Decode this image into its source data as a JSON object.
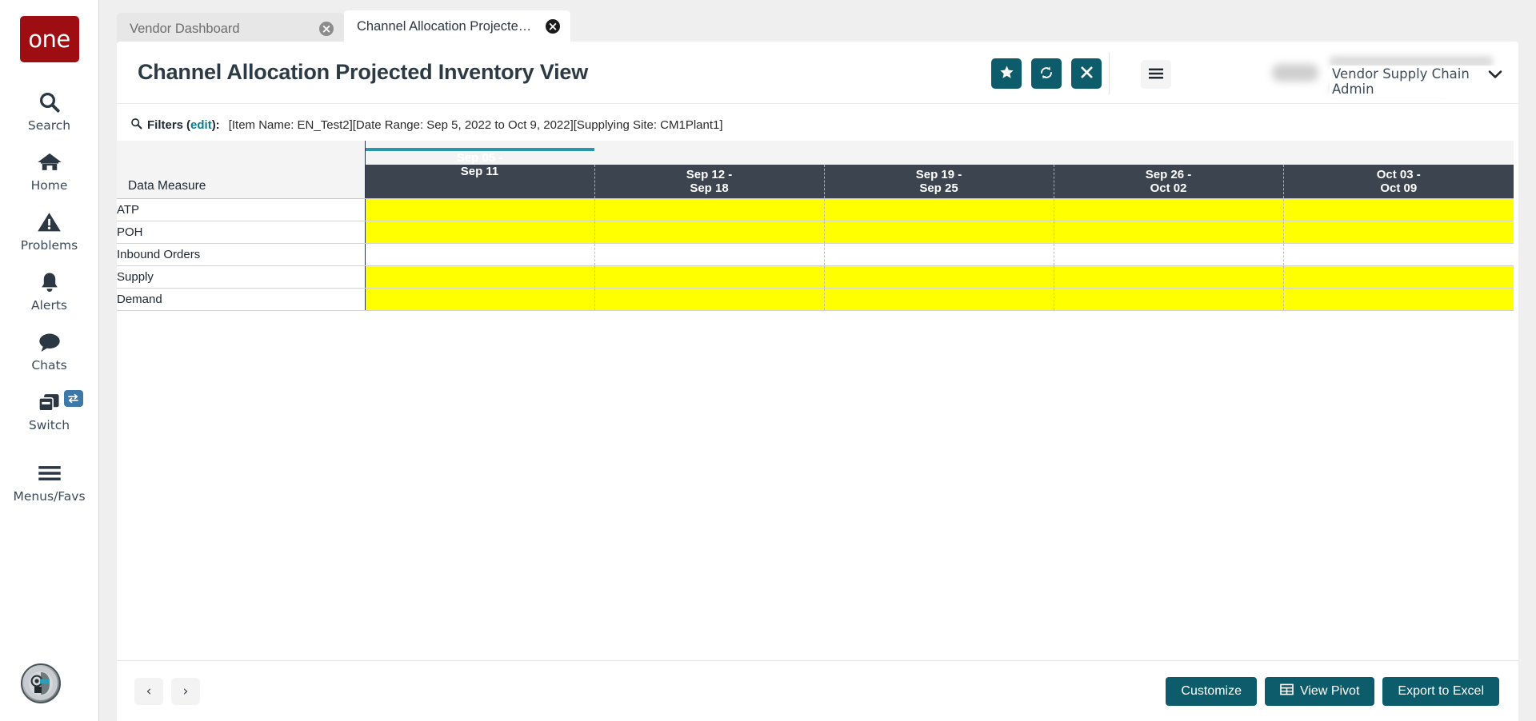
{
  "sidebar": {
    "logo_text": "one",
    "items": [
      {
        "label": "Search",
        "icon": "search-icon"
      },
      {
        "label": "Home",
        "icon": "home-icon"
      },
      {
        "label": "Problems",
        "icon": "warning-triangle-icon"
      },
      {
        "label": "Alerts",
        "icon": "bell-icon"
      },
      {
        "label": "Chats",
        "icon": "chat-bubble-icon"
      },
      {
        "label": "Switch",
        "icon": "switch-windows-icon",
        "badge": "swap-arrows-icon"
      },
      {
        "label": "Menus/Favs",
        "icon": "hamburger-icon"
      }
    ],
    "avatar": "assistant-avatar-icon"
  },
  "tabs": [
    {
      "label": "Vendor Dashboard",
      "active": false
    },
    {
      "label": "Channel Allocation Projected Inv...",
      "active": true
    }
  ],
  "header": {
    "title": "Channel Allocation Projected Inventory View",
    "actions": [
      {
        "name": "favorite-button",
        "icon": "star-icon"
      },
      {
        "name": "refresh-button",
        "icon": "refresh-icon"
      },
      {
        "name": "close-button",
        "icon": "close-x-icon"
      }
    ],
    "menu_icon": "hamburger-icon",
    "user_role": "Vendor Supply Chain Admin",
    "caret_icon": "chevron-down-icon"
  },
  "filters": {
    "icon": "search-icon",
    "label": "Filters",
    "edit_label": "edit",
    "suffix": "):",
    "open_paren": "(",
    "value": "[Item Name: EN_Test2][Date Range: Sep 5, 2022 to Oct 9, 2022][Supplying Site: CM1Plant1]"
  },
  "table": {
    "corner_header": "Data Measure",
    "columns": [
      {
        "line1": "Sep 05 -",
        "line2": "Sep 11",
        "accent": true
      },
      {
        "line1": "Sep 12 -",
        "line2": "Sep 18",
        "accent": false
      },
      {
        "line1": "Sep 19 -",
        "line2": "Sep 25",
        "accent": false
      },
      {
        "line1": "Sep 26 -",
        "line2": "Oct 02",
        "accent": false
      },
      {
        "line1": "Oct 03 -",
        "line2": "Oct 09",
        "accent": false
      }
    ],
    "rows": [
      {
        "measure": "ATP",
        "highlight": "yellow",
        "values": [
          "",
          "",
          "",
          "",
          ""
        ]
      },
      {
        "measure": "POH",
        "highlight": "yellow",
        "values": [
          "",
          "",
          "",
          "",
          ""
        ]
      },
      {
        "measure": "Inbound Orders",
        "highlight": "white",
        "values": [
          "",
          "",
          "",
          "",
          ""
        ]
      },
      {
        "measure": "Supply",
        "highlight": "yellow",
        "values": [
          "",
          "",
          "",
          "",
          ""
        ]
      },
      {
        "measure": "Demand",
        "highlight": "yellow",
        "values": [
          "",
          "",
          "",
          "",
          ""
        ]
      }
    ]
  },
  "bottom": {
    "prev_label": "‹",
    "next_label": "›",
    "customize_label": "Customize",
    "view_pivot_label": "View Pivot",
    "export_label": "Export to Excel"
  },
  "colors": {
    "accent_teal": "#2a96ac",
    "button_teal": "#0d5c6b",
    "header_dark": "#3c444f",
    "highlight_yellow": "#ffff00",
    "logo_red": "#9e0d11",
    "link_teal": "#0f7d8c"
  }
}
